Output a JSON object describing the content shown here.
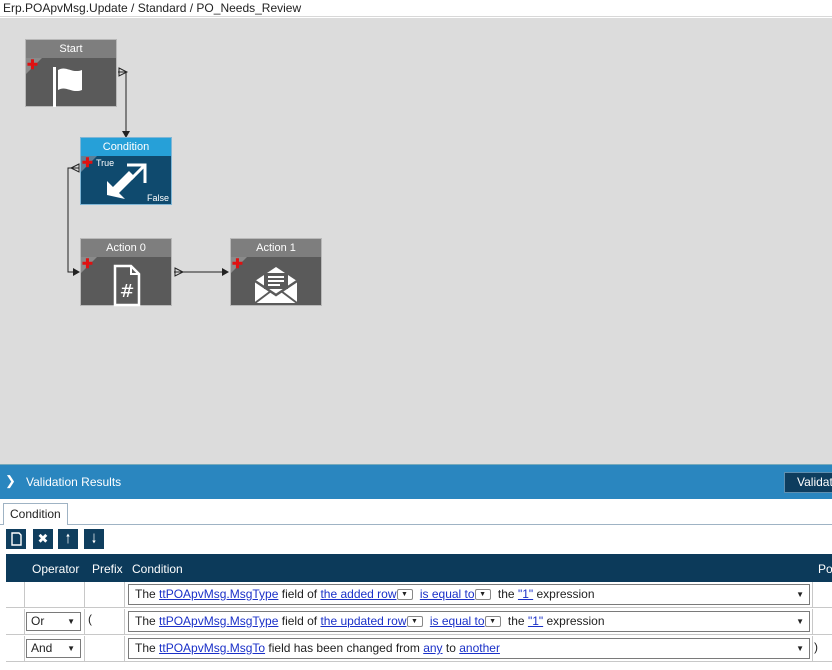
{
  "breadcrumb": "Erp.POApvMsg.Update / Standard / PO_Needs_Review",
  "nodes": {
    "start": {
      "title": "Start"
    },
    "condition": {
      "title": "Condition",
      "true_label": "True",
      "false_label": "False"
    },
    "action0": {
      "title": "Action 0"
    },
    "action1": {
      "title": "Action 1"
    }
  },
  "validation": {
    "title": "Validation Results",
    "button": "Validate"
  },
  "tabs": [
    "Condition"
  ],
  "grid": {
    "headers": {
      "operator": "Operator",
      "prefix": "Prefix",
      "condition": "Condition",
      "postfix": "Po"
    },
    "rows": [
      {
        "operator": "",
        "prefix": "",
        "postfix": "",
        "parts": {
          "t1": "The",
          "field": "ttPOApvMsg.MsgType",
          "t2": "field of",
          "row": "the added row",
          "op": "is equal to",
          "t3": "the",
          "value": "\"1\"",
          "t4": "expression"
        }
      },
      {
        "operator": "Or",
        "prefix": "(",
        "postfix": "",
        "parts": {
          "t1": "The",
          "field": "ttPOApvMsg.MsgType",
          "t2": "field of",
          "row": "the updated row",
          "op": "is equal to",
          "t3": "the",
          "value": "\"1\"",
          "t4": "expression"
        }
      },
      {
        "operator": "And",
        "prefix": "",
        "postfix": ")",
        "parts": {
          "t1": "The",
          "field": "ttPOApvMsg.MsgTo",
          "t2": "field has been changed from",
          "from": "any",
          "t3": "to",
          "to": "another"
        }
      }
    ]
  },
  "colors": {
    "condition_header": "#26a0d8",
    "condition_body": "#0f4a6e",
    "node_body": "#5a5a5a",
    "grid_header": "#0c3a5a",
    "validation_bar": "#2a86bf",
    "link": "#1a30c8"
  }
}
